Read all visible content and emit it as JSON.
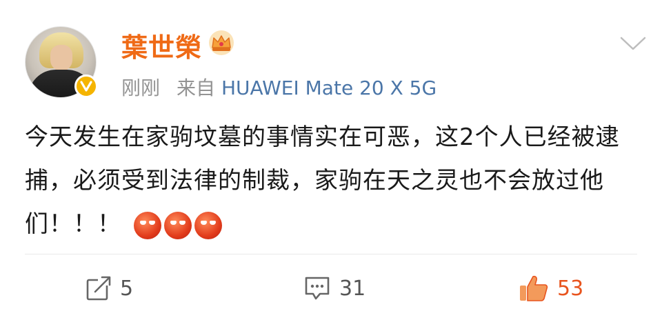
{
  "user": {
    "name": "葉世榮",
    "badge_icon": "crown-icon",
    "verified_icon": "verified-v-icon"
  },
  "meta": {
    "time": "刚刚",
    "source_prefix": "来自",
    "device": "HUAWEI Mate 20 X 5G"
  },
  "post": {
    "text": "今天发生在家驹坟墓的事情实在可恶，这2个人已经被逮捕，必须受到法律的制裁，家驹在天之灵也不会放过他们！！！",
    "emoji_names": [
      "angry-face-icon",
      "angry-face-icon",
      "angry-face-icon"
    ]
  },
  "actions": {
    "repost_count": "5",
    "comment_count": "31",
    "like_count": "53"
  },
  "colors": {
    "username": "#ef6a16",
    "device_link": "#4b76a8",
    "meta": "#939393",
    "like": "#e8541e"
  }
}
